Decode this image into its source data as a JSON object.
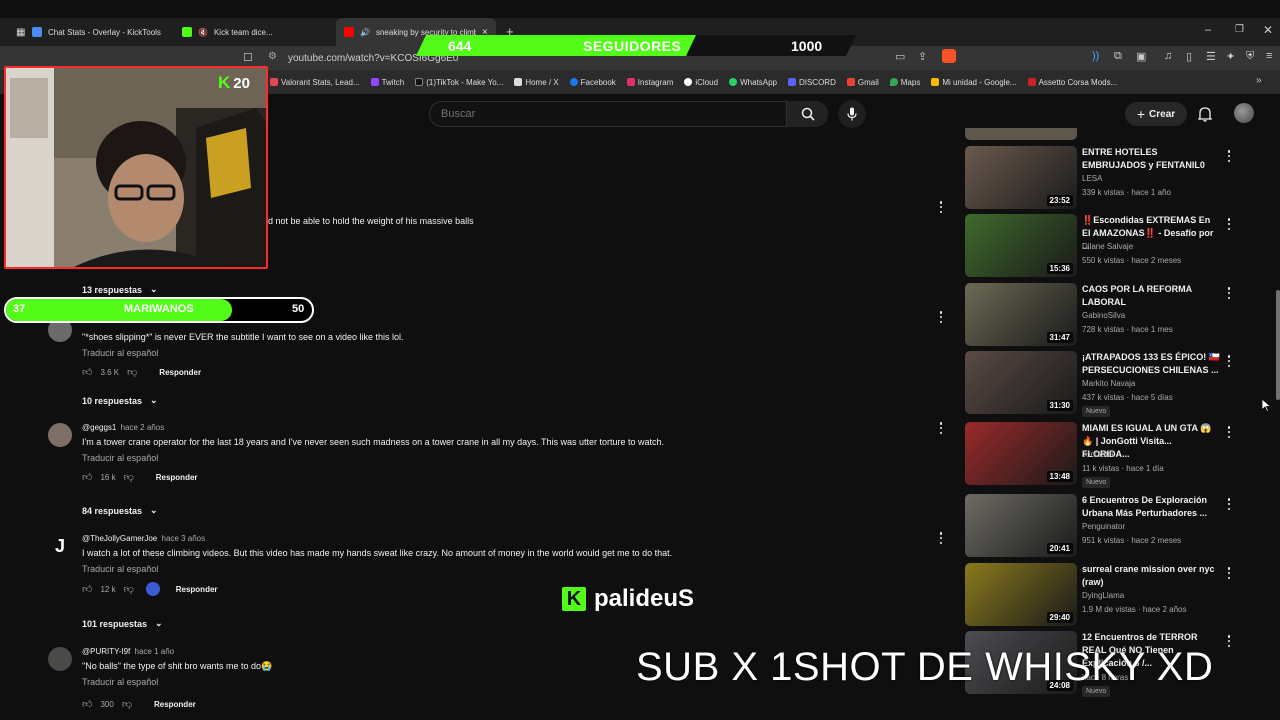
{
  "browser": {
    "tabs": [
      {
        "title": "Chat Stats - Overlay - KickTools",
        "active": false,
        "color": "#4a8df8"
      },
      {
        "title": "Kick team dice...",
        "active": false,
        "color": "#53fc18"
      },
      {
        "title": "sneaking by security to climb",
        "active": true,
        "color": "#ff0000"
      }
    ],
    "url": "youtube.com/watch?v=KCOSI6Gg6E0",
    "bookmarks": [
      {
        "label": "Valorant Stats, Lead...",
        "color": "#e5484d"
      },
      {
        "label": "Twitch",
        "color": "#9146ff"
      },
      {
        "label": "(1)TikTok - Make Yo...",
        "color": "#222222"
      },
      {
        "label": "Home / X",
        "color": "#dddddd"
      },
      {
        "label": "Facebook",
        "color": "#1877f2"
      },
      {
        "label": "Instagram",
        "color": "#e1306c"
      },
      {
        "label": "iCloud",
        "color": "#ffffff"
      },
      {
        "label": "WhatsApp",
        "color": "#25d366"
      },
      {
        "label": "DISCORD",
        "color": "#5865f2"
      },
      {
        "label": "Gmail",
        "color": "#ea4335"
      },
      {
        "label": "Maps",
        "color": "#34a853"
      },
      {
        "label": "Mi unidad - Google...",
        "color": "#fbbc04"
      },
      {
        "label": "Assetto Corsa Mods...",
        "color": "#cc2222"
      }
    ]
  },
  "youtube": {
    "search_placeholder": "Buscar",
    "create_label": "Crear"
  },
  "comments": {
    "first": {
      "text": "d not be able to hold the weight of his massive balls",
      "replies": "13 respuestas"
    },
    "items": [
      {
        "author": "",
        "when": "",
        "text": "\"*shoes slipping*\" is never EVER the subtitle I want to see on a video like this lol.",
        "translate": "Traducir al español",
        "likes": "3.6 K",
        "reply": "Responder",
        "replies": "10 respuestas"
      },
      {
        "author": "@geggs1",
        "when": "hace 2 años",
        "text": "I'm a tower crane operator for the last 18 years and I've never seen such madness on a tower crane in all my days. This was utter torture to watch.",
        "translate": "Traducir al español",
        "likes": "16 k",
        "reply": "Responder",
        "replies": "84 respuestas"
      },
      {
        "author": "@TheJollyGamerJoe",
        "when": "hace 3 años",
        "text": "I watch a lot of these climbing videos. But this video has made my hands sweat like crazy. No amount of money in the world would get me to do that.",
        "translate": "Traducir al español",
        "likes": "12 k",
        "reply": "Responder",
        "replies": "101 respuestas"
      },
      {
        "author": "@PURITY-I9f",
        "when": "hace 1 año",
        "text": "\"No balls\" the type of shit bro wants me to do😭",
        "translate": "Traducir al español",
        "likes": "300",
        "reply": "Responder",
        "replies": ""
      }
    ]
  },
  "sidebar_videos": [
    {
      "title": "ENTRE HOTELES EMBRUJADOS y FENTANIL0",
      "channel": "LESA",
      "meta": "339 k vistas · hace 1 año",
      "duration": "23:52",
      "badge": "",
      "thumb_color": "#6b5a4e"
    },
    {
      "title": "‼️Escondidas EXTREMAS En El AMAZONAS‼️ - Desafío por ...",
      "channel": "Dilane Salvaje",
      "meta": "550 k vistas · hace 2 meses",
      "duration": "15:36",
      "badge": "",
      "thumb_color": "#3f6b2c"
    },
    {
      "title": "CAOS POR LA REFORMA LABORAL",
      "channel": "GabinoSilva",
      "meta": "728 k vistas · hace 1 mes",
      "duration": "31:47",
      "badge": "",
      "thumb_color": "#6c6a55"
    },
    {
      "title": "¡ATRAPADOS 133 ES ÉPICO! 🇨🇱 PERSECUCIONES CHILENAS ...",
      "channel": "Markito Navaja",
      "meta": "437 k vistas · hace 5 días",
      "duration": "31:30",
      "badge": "Nuevo",
      "thumb_color": "#5a4a44"
    },
    {
      "title": "MIAMI ES IGUAL A UN GTA 😱🔥 | JonGotti Visita... FLORIDA...",
      "channel": "JonGottii",
      "meta": "11 k vistas · hace 1 día",
      "duration": "13:48",
      "badge": "Nuevo",
      "thumb_color": "#9a2a2a"
    },
    {
      "title": "6 Encuentros De Exploración Urbana Más Perturbadores ...",
      "channel": "Penguinator",
      "meta": "951 k vistas · hace 2 meses",
      "duration": "20:41",
      "badge": "",
      "thumb_color": "#6d6b63"
    },
    {
      "title": "surreal crane mission over nyc (raw)",
      "channel": "DyingLlama",
      "meta": "1.9 M de vistas · hace 2 años",
      "duration": "29:40",
      "badge": "",
      "thumb_color": "#8a7a1c"
    },
    {
      "title": "12 Encuentros de TERROR REAL Qué NO Tienen Explicación 6 /...",
      "channel": "",
      "meta": "hace 8 horas",
      "duration": "24:08",
      "badge": "Nuevo",
      "thumb_color": "#4d4d52"
    }
  ],
  "overlay": {
    "followers_current": "644",
    "followers_label": "SEGUIDORES",
    "followers_goal": "1000",
    "followers_progress": 0.644,
    "kick_count": "20",
    "goal_left": "37",
    "goal_label": "MARIWANOS",
    "goal_right": "50",
    "goal_progress": 0.74,
    "streamer": "palideuS",
    "banner_text": "SUB X 1SHOT DE WHISKY XD",
    "kick_green": "#53fc18"
  }
}
